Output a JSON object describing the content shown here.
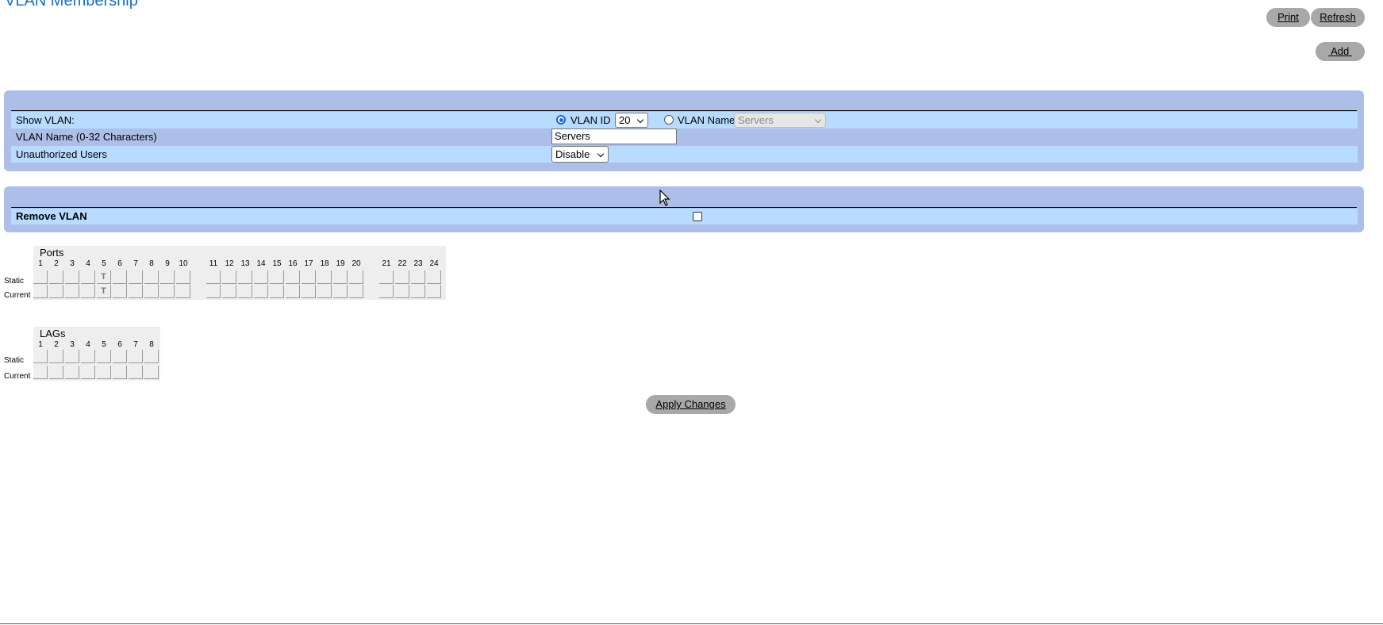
{
  "page": {
    "title": "VLAN Membership"
  },
  "toolbar": {
    "print": "Print",
    "refresh": "Refresh",
    "add": " Add "
  },
  "settings": {
    "show_vlan_label": "Show VLAN:",
    "vlan_id_label": "VLAN ID",
    "vlan_id_value": "20",
    "vlan_name_label": "VLAN Name",
    "vlan_name_select_value": "Servers",
    "vlan_name_field_label": "VLAN Name (0-32 Characters)",
    "vlan_name_field_value": "Servers",
    "unauth_label": "Unauthorized Users",
    "unauth_value": "Disable"
  },
  "remove": {
    "label": "Remove VLAN"
  },
  "ports": {
    "title": "Ports",
    "row_labels": [
      "Static",
      "Current"
    ],
    "numbers": [
      "1",
      "2",
      "3",
      "4",
      "5",
      "6",
      "7",
      "8",
      "9",
      "10",
      "11",
      "12",
      "13",
      "14",
      "15",
      "16",
      "17",
      "18",
      "19",
      "20",
      "21",
      "22",
      "23",
      "24"
    ],
    "static": [
      "",
      "",
      "",
      "",
      "T",
      "",
      "",
      "",
      "",
      "",
      "",
      "",
      "",
      "",
      "",
      "",
      "",
      "",
      "",
      "",
      "",
      "",
      "",
      ""
    ],
    "current": [
      "",
      "",
      "",
      "",
      "T",
      "",
      "",
      "",
      "",
      "",
      "",
      "",
      "",
      "",
      "",
      "",
      "",
      "",
      "",
      "",
      "",
      "",
      "",
      ""
    ]
  },
  "lags": {
    "title": "LAGs",
    "row_labels": [
      "Static",
      "Current"
    ],
    "numbers": [
      "1",
      "2",
      "3",
      "4",
      "5",
      "6",
      "7",
      "8"
    ],
    "static": [
      "",
      "",
      "",
      "",
      "",
      "",
      "",
      ""
    ],
    "current": [
      "",
      "",
      "",
      "",
      "",
      "",
      "",
      ""
    ]
  },
  "apply": {
    "label": "Apply Changes"
  },
  "icons": {
    "cursor": "mouse-pointer-icon"
  }
}
